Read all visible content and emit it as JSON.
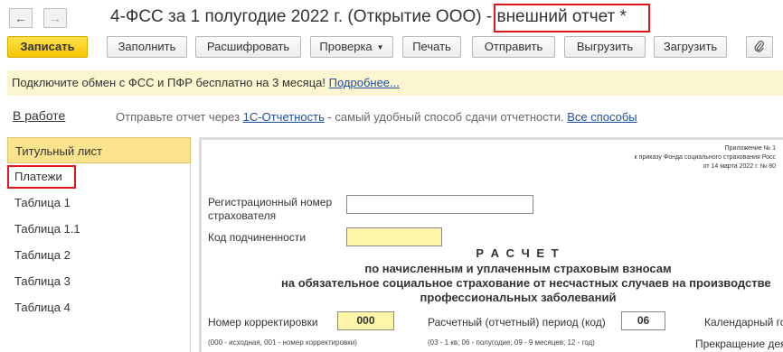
{
  "window": {
    "title": "4-ФСС за 1 полугодие 2022 г. (Открытие ООО) - ",
    "title_suffix": "внешний отчет *"
  },
  "nav": {
    "back_icon": "←",
    "forward_icon": "→"
  },
  "toolbar": {
    "save_label": "Записать",
    "fill_label": "Заполнить",
    "decode_label": "Расшифровать",
    "check_label": "Проверка",
    "print_label": "Печать",
    "send_label": "Отправить",
    "export_label": "Выгрузить",
    "import_label": "Загрузить",
    "attach_icon": "paperclip-icon"
  },
  "notice": {
    "text": "Подключите обмен с ФСС и ПФР бесплатно на 3 месяца! ",
    "link": "Подробнее..."
  },
  "status": {
    "label": "В работе",
    "text_before": "Отправьте отчет через ",
    "link1": "1С-Отчетность",
    "text_mid": " - самый удобный способ сдачи отчетности. ",
    "link2": "Все способы"
  },
  "sidebar": {
    "items": [
      {
        "label": "Титульный лист"
      },
      {
        "label": "Платежи"
      },
      {
        "label": "Таблица 1"
      },
      {
        "label": "Таблица 1.1"
      },
      {
        "label": "Таблица 2"
      },
      {
        "label": "Таблица 3"
      },
      {
        "label": "Таблица 4"
      }
    ]
  },
  "form": {
    "appendix_line1": "Приложение № 1",
    "appendix_line2": "к приказу Фонда социального страхования Росс",
    "appendix_line3": "от 14 марта 2022 г. № 80",
    "reg_number_label_1": "Регистрационный номер",
    "reg_number_label_2": "страхователя",
    "reg_number_value": "",
    "subordination_label": "Код подчиненности",
    "subordination_value": "",
    "heading_title": "Р А С Ч Е Т",
    "heading_line1": "по начисленным и уплаченным страховым взносам",
    "heading_line2": "на обязательное социальное страхование от несчастных случаев на производстве",
    "heading_line3": "профессиональных заболеваний",
    "correction_label": "Номер корректировки",
    "correction_value": "000",
    "correction_hint": "(000 - исходная, 001 - номер корректировки)",
    "period_label": "Расчетный (отчетный) период  (код)",
    "period_value": "06",
    "period_hint": "(03 - 1 кв; 06 - полугодие; 09 - 9 месяцев; 12 - год)",
    "calendar_label": "Календарный го",
    "termination_label": "Прекращение дея"
  }
}
